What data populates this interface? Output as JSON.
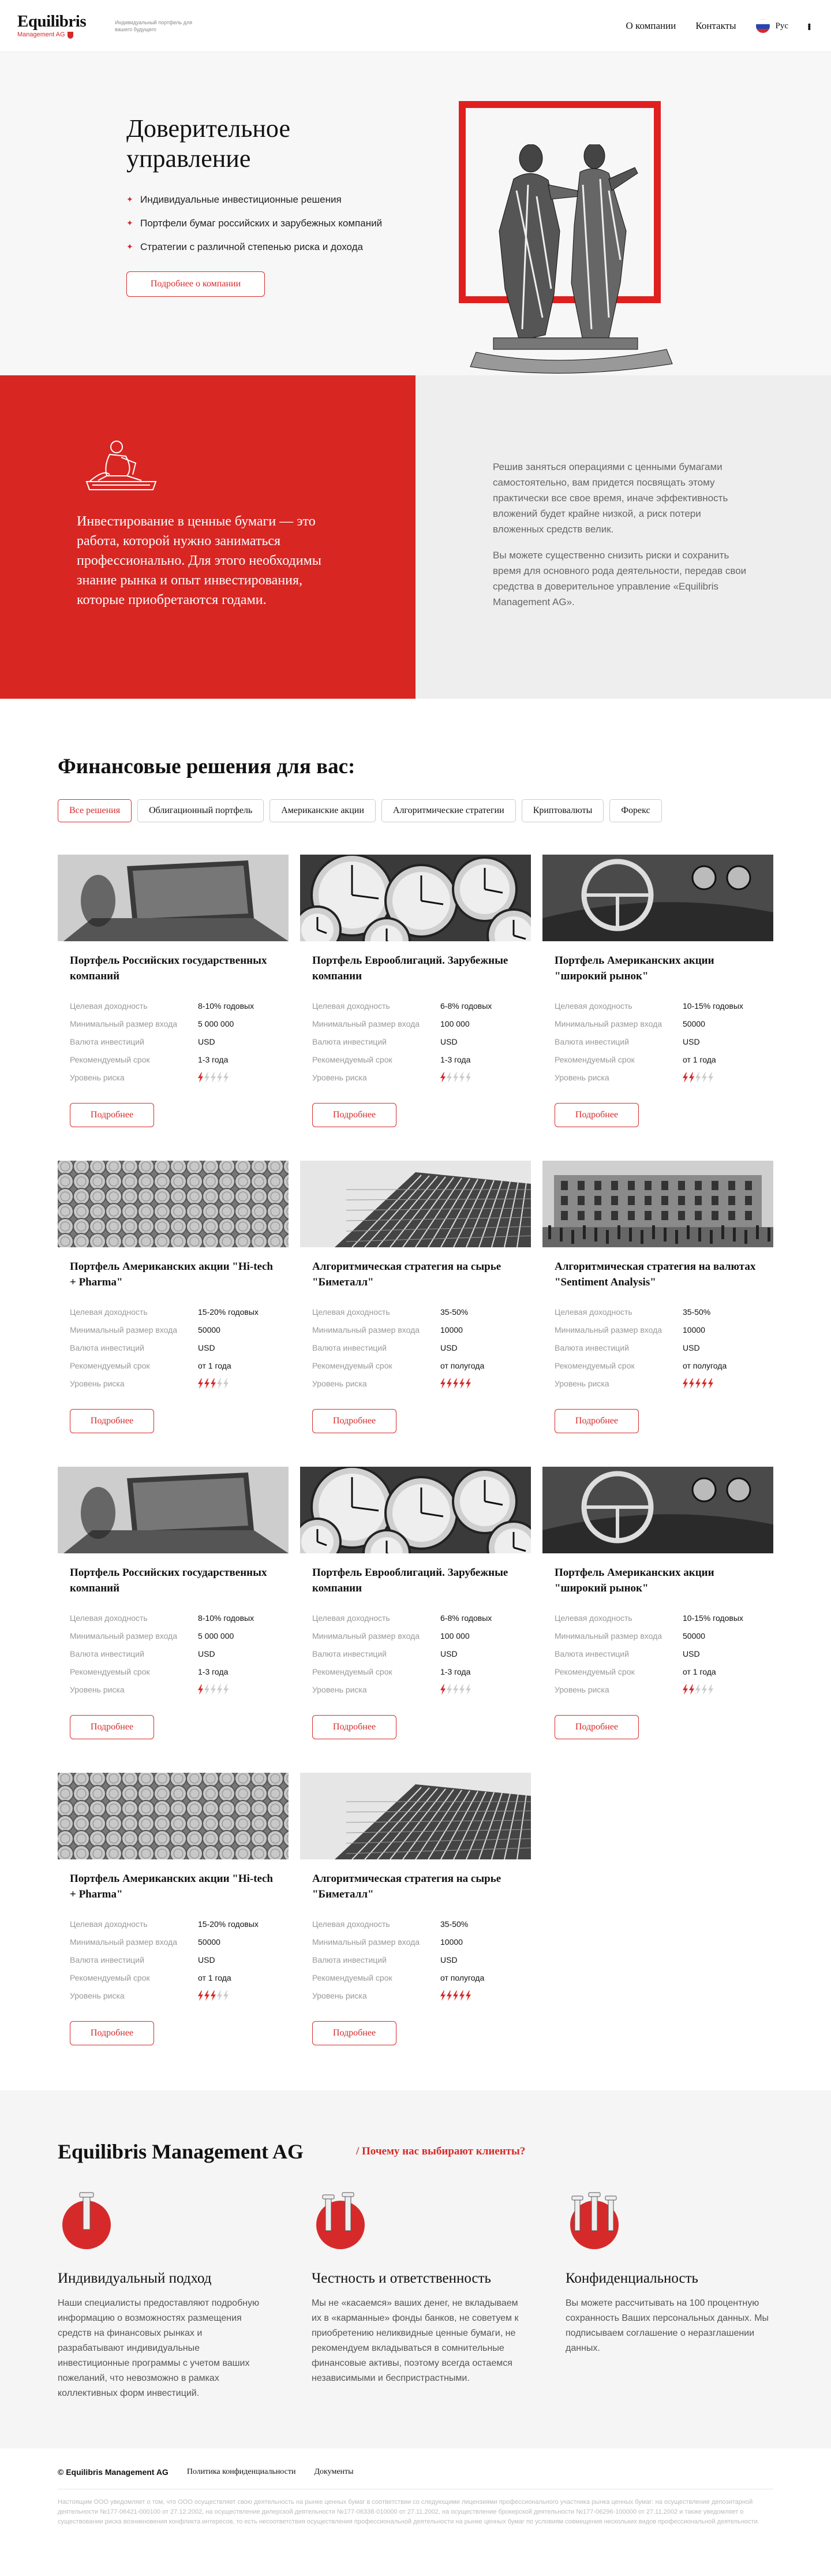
{
  "header": {
    "logo": "Equilibris",
    "logo_sub": "Management AG",
    "tagline": "Индивидуальный портфель для вашего будущего",
    "nav": [
      "О компании",
      "Контакты"
    ],
    "lang": "Рус"
  },
  "hero": {
    "title": "Доверительное управление",
    "bullets": [
      "Индивидуальные инвестиционные решения",
      "Портфели бумаг российских и зарубежных компаний",
      "Стратегии с различной степенью риска и дохода"
    ],
    "button": "Подробнее о компании"
  },
  "about": {
    "quote": "Инвестирование в ценные бумаги — это работа, которой нужно заниматься профессионально. Для этого необходимы знание рынка и опыт инвестирования, которые приобретаются годами.",
    "p1": "Решив заняться операциями с ценными бумагами самостоятельно, вам придется посвящать этому практически все свое время, иначе эффективность вложений будет крайне низкой, а риск потери вложенных средств велик.",
    "p2": "Вы можете существенно снизить риски и сохранить время для основного рода деятельности, передав свои средства в доверительное управление «Equilibris Management AG»."
  },
  "solutions": {
    "title": "Финансовые решения для вас:",
    "filters": [
      "Все решения",
      "Облигационный портфель",
      "Американские акции",
      "Алгоритмические стратегии",
      "Криптовалюты",
      "Форекс"
    ],
    "spec_labels": [
      "Целевая доходность",
      "Минимальный размер входа",
      "Валюта инвестиций",
      "Рекомендуемый срок",
      "Уровень риска"
    ],
    "button": "Подробнее",
    "cards": [
      {
        "title": "Портфель Российских государственных компаний",
        "yield": "8-10% годовых",
        "min": "5 000 000",
        "currency": "USD",
        "term": "1-3 года",
        "risk": 1,
        "img": "laptop"
      },
      {
        "title": "Портфель Еврооблигаций. Зарубежные компании",
        "yield": "6-8% годовых",
        "min": "100 000",
        "currency": "USD",
        "term": "1-3 года",
        "risk": 1,
        "img": "clocks"
      },
      {
        "title": "Портфель Американских акции \"широкий рынок\"",
        "yield": "10-15% годовых",
        "min": "50000",
        "currency": "USD",
        "term": "от 1 года",
        "risk": 2,
        "img": "car"
      },
      {
        "title": "Портфель Американских акции \"Hi-tech + Pharma\"",
        "yield": "15-20% годовых",
        "min": "50000",
        "currency": "USD",
        "term": "от 1 года",
        "risk": 3,
        "img": "coins"
      },
      {
        "title": "Алгоритмическая стратегия на сырье \"Биметалл\"",
        "yield": "35-50%",
        "min": "10000",
        "currency": "USD",
        "term": "от полугода",
        "risk": 5,
        "img": "building"
      },
      {
        "title": "Алгоритмическая стратегия на валютах \"Sentiment Analysis\"",
        "yield": "35-50%",
        "min": "10000",
        "currency": "USD",
        "term": "от полугода",
        "risk": 5,
        "img": "city"
      },
      {
        "title": "Портфель Российских государственных компаний",
        "yield": "8-10% годовых",
        "min": "5 000 000",
        "currency": "USD",
        "term": "1-3 года",
        "risk": 1,
        "img": "laptop"
      },
      {
        "title": "Портфель Еврооблигаций. Зарубежные компании",
        "yield": "6-8% годовых",
        "min": "100 000",
        "currency": "USD",
        "term": "1-3 года",
        "risk": 1,
        "img": "clocks"
      },
      {
        "title": "Портфель Американских акции \"широкий рынок\"",
        "yield": "10-15% годовых",
        "min": "50000",
        "currency": "USD",
        "term": "от 1 года",
        "risk": 2,
        "img": "car"
      },
      {
        "title": "Портфель Американских акции \"Hi-tech + Pharma\"",
        "yield": "15-20% годовых",
        "min": "50000",
        "currency": "USD",
        "term": "от 1 года",
        "risk": 3,
        "img": "coins"
      },
      {
        "title": "Алгоритмическая стратегия на сырье \"Биметалл\"",
        "yield": "35-50%",
        "min": "10000",
        "currency": "USD",
        "term": "от полугода",
        "risk": 5,
        "img": "building"
      }
    ]
  },
  "why": {
    "title": "Equilibris Management AG",
    "subtitle": "/ Почему нас выбирают клиенты?",
    "features": [
      {
        "title": "Индивидуальный подход",
        "text": "Наши специалисты предоставляют подробную информацию о возможностях размещения средств на финансовых рынках и разрабатывают индивидуальные инвестиционные программы с учетом ваших пожеланий, что невозможно в рамках коллективных форм инвестиций."
      },
      {
        "title": "Честность и ответственность",
        "text": "Мы не «касаемся» ваших денег, не вкладываем их в «карманные» фонды банков, не советуем к приобретению неликвидные ценные бумаги, не рекомендуем вкладываться в сомнительные финансовые активы, поэтому всегда остаемся независимыми и беспристрастными."
      },
      {
        "title": "Конфиденциальность",
        "text": "Вы можете рассчитывать на 100 процентную сохранность Ваших персональных данных. Мы подписываем соглашение о неразглашении данных."
      }
    ]
  },
  "footer": {
    "copyright": "© Equilibris Management AG",
    "links": [
      "Политика конфиденциальности",
      "Документы"
    ],
    "legal": "Настоящим ООО уведомляет о том, что ООО осуществляет свою деятельность на рынке ценных бумаг в соответствии со следующими лицензиями профессионального участника рынка ценных бумаг: на осуществление депозитарной деятельности №177-06421-000100 от 27.12.2002, на осуществление дилерской деятельности №177-06338-010000 от 27.11.2002, на осуществление брокерской деятельности №177-06296-100000 от 27.11.2002 и также уведомляет о существовании риска возникновения конфликта интересов, то есть несоответствия осуществления профессиональной деятельности на рынке ценных бумаг по условиям совмещения нескольких видов профессиональной деятельности."
  }
}
